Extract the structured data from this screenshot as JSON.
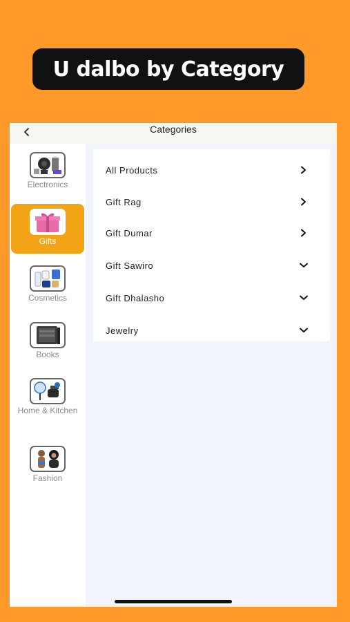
{
  "banner": {
    "title": "U dalbo by Category"
  },
  "header": {
    "title": "Categories",
    "back_icon": "chevron-left-icon"
  },
  "colors": {
    "background": "#FF9A2A",
    "accent": "#F2A416",
    "banner_bg": "#111111",
    "main_bg": "#F1F5FB"
  },
  "sidebar": {
    "items": [
      {
        "label": "Electronics",
        "icon": "electronics-icon",
        "active": false
      },
      {
        "label": "Gifts",
        "icon": "gift-box-icon",
        "active": true
      },
      {
        "label": "Cosmetics",
        "icon": "cosmetics-icon",
        "active": false
      },
      {
        "label": "Books",
        "icon": "books-icon",
        "active": false
      },
      {
        "label": "Home & Kitchen",
        "icon": "home-kitchen-icon",
        "active": false
      },
      {
        "label": "Fashion",
        "icon": "fashion-icon",
        "active": false
      }
    ]
  },
  "subcategories": {
    "items": [
      {
        "label": "All Products",
        "chevron": "chevron-right-icon"
      },
      {
        "label": "Gift Rag",
        "chevron": "chevron-right-icon"
      },
      {
        "label": "Gift Dumar",
        "chevron": "chevron-right-icon"
      },
      {
        "label": "Gift Sawiro",
        "chevron": "chevron-down-icon"
      },
      {
        "label": "Gift Dhalasho",
        "chevron": "chevron-down-icon"
      },
      {
        "label": "Jewelry",
        "chevron": "chevron-down-icon"
      }
    ]
  }
}
